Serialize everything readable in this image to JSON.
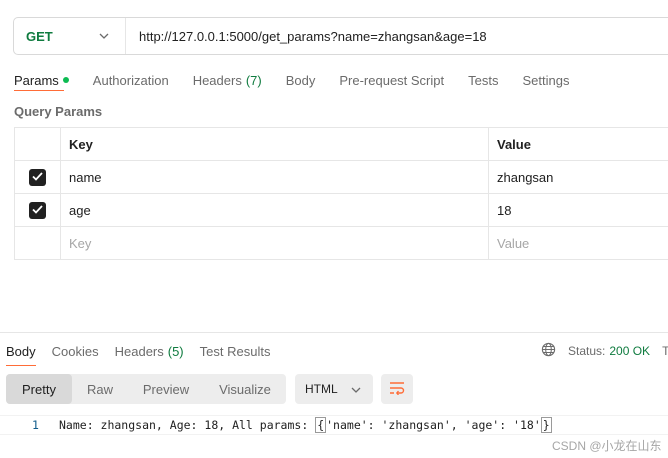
{
  "request": {
    "method": "GET",
    "url": "http://127.0.0.1:5000/get_params?name=zhangsan&age=18"
  },
  "request_tabs": [
    {
      "label": "Params"
    },
    {
      "label": "Authorization"
    },
    {
      "label": "Headers",
      "count": "(7)"
    },
    {
      "label": "Body"
    },
    {
      "label": "Pre-request Script"
    },
    {
      "label": "Tests"
    },
    {
      "label": "Settings"
    }
  ],
  "query_params": {
    "title": "Query Params",
    "headers": {
      "key": "Key",
      "value": "Value"
    },
    "rows": [
      {
        "key": "name",
        "value": "zhangsan"
      },
      {
        "key": "age",
        "value": "18"
      }
    ],
    "placeholder": {
      "key": "Key",
      "value": "Value"
    }
  },
  "response_tabs": [
    {
      "label": "Body"
    },
    {
      "label": "Cookies"
    },
    {
      "label": "Headers",
      "count": "(5)"
    },
    {
      "label": "Test Results"
    }
  ],
  "status": {
    "label": "Status:",
    "value": "200 OK",
    "cut": "T"
  },
  "format_buttons": [
    "Pretty",
    "Raw",
    "Preview",
    "Visualize"
  ],
  "language": "HTML",
  "response_body": {
    "line_number": "1",
    "prefix": "Name: zhangsan, Age: 18, All params: ",
    "open_brace": "{",
    "middle": "'name': 'zhangsan', 'age': '18'",
    "close_brace": "}"
  },
  "watermark": "CSDN @小龙在山东",
  "colors": {
    "accent": "#ff6c37",
    "method_green": "#0f7b3f",
    "status_green": "#0f7b3f"
  }
}
